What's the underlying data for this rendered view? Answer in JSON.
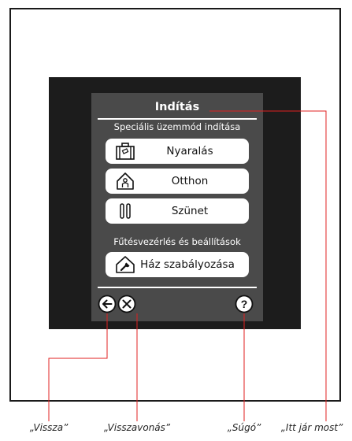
{
  "screen": {
    "title": "Indítás",
    "section1": "Speciális üzemmód indítása",
    "section2": "Fűtésvezérlés és beállítások",
    "buttons": [
      {
        "label": "Nyaralás",
        "icon": "suitcase-icon"
      },
      {
        "label": "Otthon",
        "icon": "house-person-icon"
      },
      {
        "label": "Szünet",
        "icon": "pause-icon"
      }
    ],
    "settings_button": {
      "label": "Ház szabályozása",
      "icon": "house-wrench-icon"
    },
    "nav": {
      "back_icon": "back-arrow-icon",
      "cancel_icon": "cancel-x-icon",
      "help_icon": "help-icon"
    }
  },
  "captions": {
    "back": "„Vissza”",
    "cancel": "„Visszavonás”",
    "help": "„Súgó”",
    "here": "„Itt jár most”"
  },
  "colors": {
    "screen_bg": "#4a4a4a",
    "bezel": "#1c1c1c",
    "callout_line": "#e02020"
  }
}
